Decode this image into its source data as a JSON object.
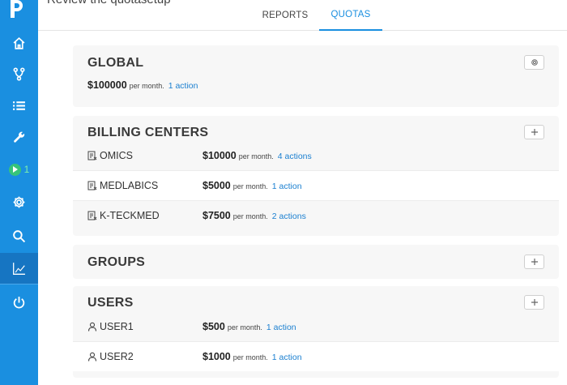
{
  "colors": {
    "sidebar": "#1a8fe0",
    "accent": "#1a8fe0",
    "link": "#1a7fd0",
    "run": "#37c47a"
  },
  "header": {
    "title": "Review the quotasetup"
  },
  "tabs": [
    {
      "label": "REPORTS",
      "active": false
    },
    {
      "label": "QUOTAS",
      "active": true
    }
  ],
  "sidebar": {
    "items": [
      {
        "icon": "home-icon"
      },
      {
        "icon": "branch-icon"
      },
      {
        "icon": "list-icon"
      },
      {
        "icon": "wrench-icon"
      },
      {
        "icon": "play-icon",
        "count": "1"
      },
      {
        "icon": "gear-icon"
      },
      {
        "icon": "search-icon"
      },
      {
        "icon": "chart-icon",
        "active": true
      },
      {
        "icon": "power-icon"
      }
    ]
  },
  "global": {
    "title": "GLOBAL",
    "amount": "$100000",
    "period": "per month.",
    "actions": "1 action",
    "button_icon": "gear-icon"
  },
  "billing": {
    "title": "BILLING CENTERS",
    "button_icon": "plus-icon",
    "rows": [
      {
        "name": "OMICS",
        "amount": "$10000",
        "period": "per month.",
        "actions": "4 actions"
      },
      {
        "name": "MEDLABICS",
        "amount": "$5000",
        "period": "per month.",
        "actions": "1 action"
      },
      {
        "name": "K-TECKMED",
        "amount": "$7500",
        "period": "per month.",
        "actions": "2 actions"
      }
    ]
  },
  "groups": {
    "title": "GROUPS",
    "button_icon": "plus-icon"
  },
  "users": {
    "title": "USERS",
    "button_icon": "plus-icon",
    "rows": [
      {
        "name": "USER1",
        "amount": "$500",
        "period": "per month.",
        "actions": "1 action"
      },
      {
        "name": "USER2",
        "amount": "$1000",
        "period": "per month.",
        "actions": "1 action"
      }
    ]
  }
}
